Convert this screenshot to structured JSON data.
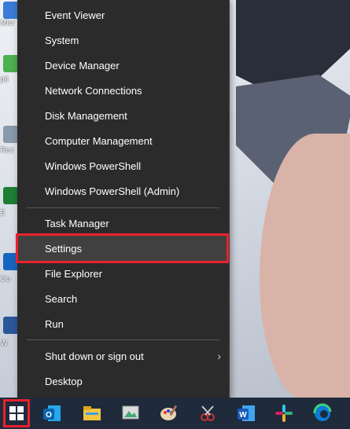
{
  "menu": {
    "items": [
      {
        "label": "Event Viewer"
      },
      {
        "label": "System"
      },
      {
        "label": "Device Manager"
      },
      {
        "label": "Network Connections"
      },
      {
        "label": "Disk Management"
      },
      {
        "label": "Computer Management"
      },
      {
        "label": "Windows PowerShell"
      },
      {
        "label": "Windows PowerShell (Admin)"
      },
      {
        "label": "Task Manager"
      },
      {
        "label": "Settings"
      },
      {
        "label": "File Explorer"
      },
      {
        "label": "Search"
      },
      {
        "label": "Run"
      },
      {
        "label": "Shut down or sign out"
      },
      {
        "label": "Desktop"
      }
    ],
    "highlighted": "Settings",
    "highlight_color": "#e8222d"
  },
  "desktop": {
    "labels": [
      "Micr",
      "pit",
      "Rec",
      "E",
      "Ou",
      "W"
    ]
  },
  "taskbar": {
    "icons": [
      "windows-start-icon",
      "outlook-icon",
      "file-explorer-icon",
      "image-viewer-icon",
      "paint-icon",
      "snipping-tool-icon",
      "word-icon",
      "slack-icon",
      "edge-icon"
    ]
  }
}
